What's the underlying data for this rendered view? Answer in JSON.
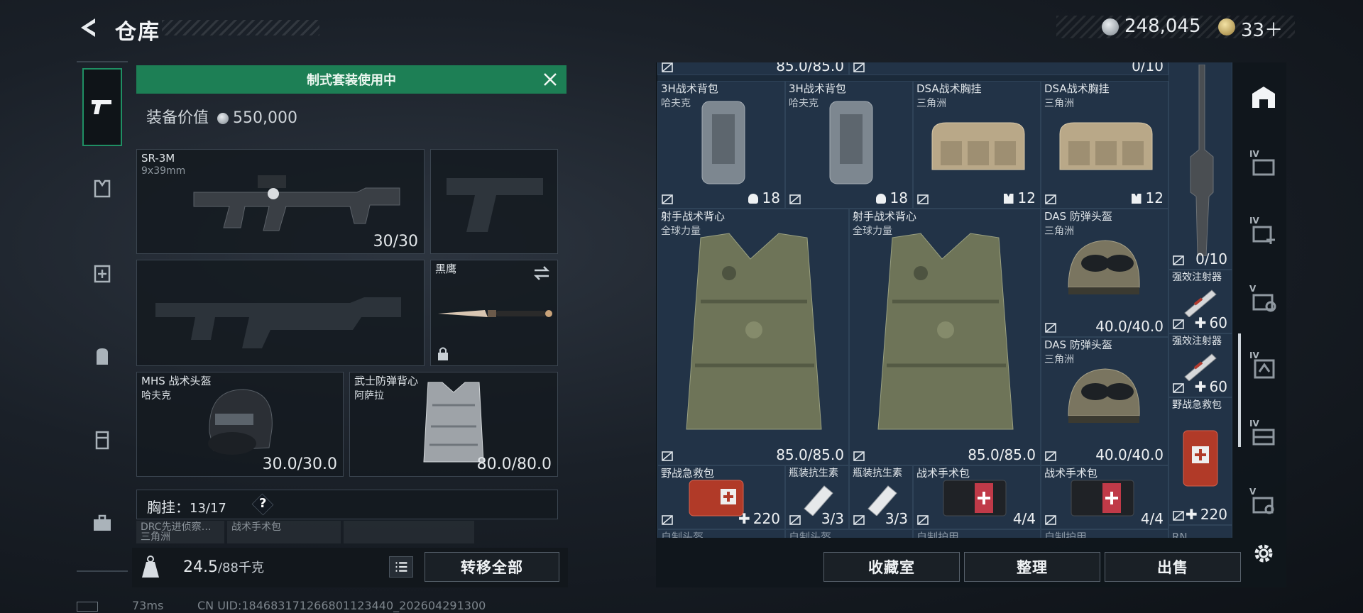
{
  "header": {
    "title": "仓库",
    "money": "248,045",
    "tickets": "33＋"
  },
  "loadout": {
    "banner": "制式套装使用中",
    "value_label": "装备价值",
    "value": "550,000",
    "primary_weapon": {
      "name": "SR-3M",
      "ammo_type": "9x39mm",
      "ammo": "30/30"
    },
    "melee": {
      "name": "黑鹰"
    },
    "helmet": {
      "name": "MHS 战术头盔",
      "brand": "哈夫克",
      "durability": "30.0/30.0"
    },
    "armor": {
      "name": "武士防弹背心",
      "brand": "阿萨拉",
      "durability": "80.0/80.0"
    },
    "rig": {
      "label": "胸挂：",
      "capacity": "13/17",
      "help": "?"
    },
    "rig_peek": [
      "DRC先进侦察…",
      "三角洲",
      "战术手术包"
    ],
    "weight": "24.5",
    "weight_unit": "/88千克",
    "transfer_all": "转移全部"
  },
  "storage": {
    "top_row": [
      "85.0/85.0",
      "0/10"
    ],
    "items": [
      {
        "name": "3H战术背包",
        "brand": "哈夫克",
        "value": "18"
      },
      {
        "name": "3H战术背包",
        "brand": "哈夫克",
        "value": "18"
      },
      {
        "name": "DSA战术胸挂",
        "brand": "三角洲",
        "value": "12"
      },
      {
        "name": "DSA战术胸挂",
        "brand": "三角洲",
        "value": "12"
      },
      {
        "name": "射手战术背心",
        "brand": "全球力量",
        "value": "85.0/85.0"
      },
      {
        "name": "射手战术背心",
        "brand": "全球力量",
        "value": "85.0/85.0"
      },
      {
        "name": "DAS 防弹头盔",
        "brand": "三角洲",
        "value": "40.0/40.0"
      },
      {
        "name": "DAS 防弹头盔",
        "brand": "三角洲",
        "value": "40.0/40.0"
      },
      {
        "name": "",
        "brand": "",
        "value": "0/10"
      },
      {
        "name": "强效注射器",
        "brand": "",
        "value": "60"
      },
      {
        "name": "强效注射器",
        "brand": "",
        "value": "60"
      },
      {
        "name": "野战急救包",
        "brand": "",
        "value": "220"
      },
      {
        "name": "野战急救包",
        "brand": "",
        "value": "220"
      },
      {
        "name": "瓶装抗生素",
        "brand": "",
        "value": "3/3"
      },
      {
        "name": "瓶装抗生素",
        "brand": "",
        "value": "3/3"
      },
      {
        "name": "战术手术包",
        "brand": "",
        "value": "4/4"
      },
      {
        "name": "战术手术包",
        "brand": "",
        "value": "4/4"
      }
    ],
    "bottom_peek": [
      "自制头盔",
      "自制头盔",
      "自制护甲",
      "自制护甲",
      "RN"
    ]
  },
  "actions": {
    "collection_room": "收藏室",
    "organize": "整理",
    "sell": "出售"
  },
  "right_tiers": [
    "IV",
    "IV",
    "V",
    "IV",
    "IV",
    "V"
  ],
  "status": {
    "ping": "73ms",
    "uid": "CN UID:1846831712668011234​40_202604291300"
  },
  "colors": {
    "accent_green": "#1d7f55",
    "grid_blue": "#223347",
    "background": "#1a2028"
  }
}
